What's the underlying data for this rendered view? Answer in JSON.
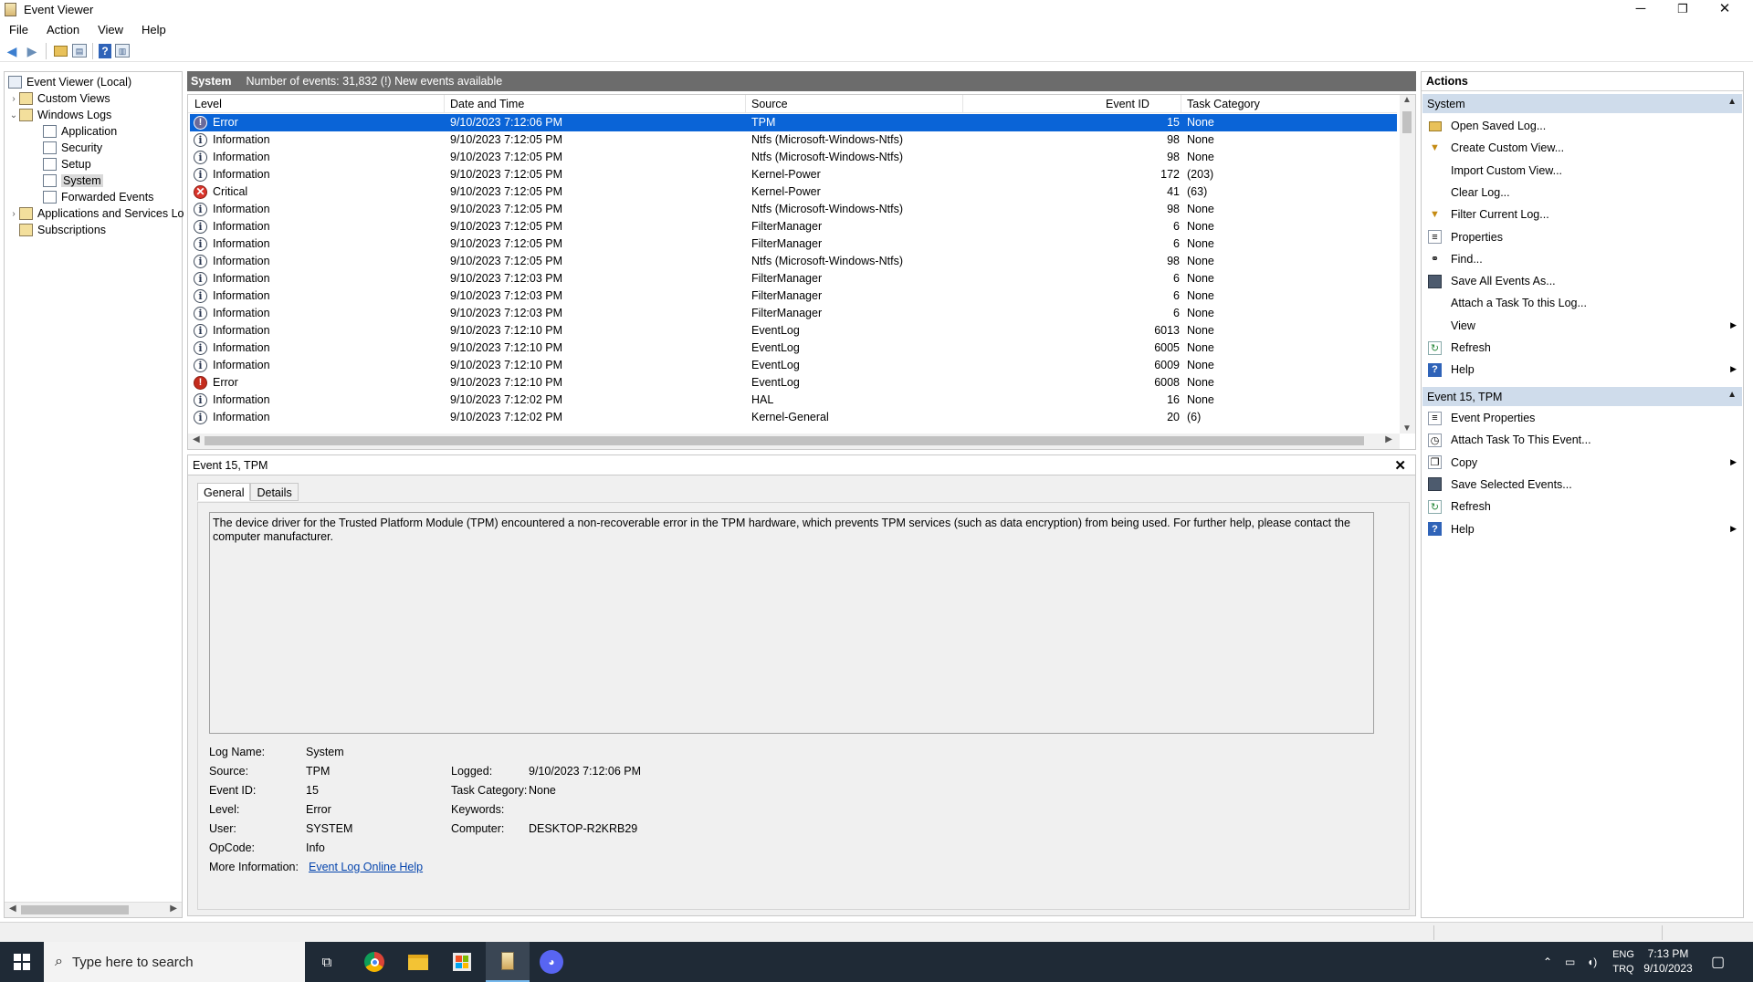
{
  "window": {
    "title": "Event Viewer",
    "controls": {
      "minimize": "─",
      "restore": "❐",
      "close": "✕"
    }
  },
  "menu": [
    "File",
    "Action",
    "View",
    "Help"
  ],
  "toolbar": [
    "back-icon",
    "forward-icon",
    "up-folder-icon",
    "show-hide-console-tree-icon",
    "help-icon",
    "show-hide-action-pane-icon"
  ],
  "tree": {
    "root": "Event Viewer (Local)",
    "custom_views": "Custom Views",
    "windows_logs": "Windows Logs",
    "logs": [
      "Application",
      "Security",
      "Setup",
      "System",
      "Forwarded Events"
    ],
    "apps_services": "Applications and Services Lo",
    "subscriptions": "Subscriptions",
    "selected": "System"
  },
  "list": {
    "title": "System",
    "summary": "Number of events: 31,832 (!) New events available",
    "columns": [
      "Level",
      "Date and Time",
      "Source",
      "Event ID",
      "Task Category"
    ],
    "rows": [
      {
        "level": "Error",
        "icon": "error",
        "date": "9/10/2023 7:12:06 PM",
        "source": "TPM",
        "id": "15",
        "cat": "None"
      },
      {
        "level": "Information",
        "icon": "info",
        "date": "9/10/2023 7:12:05 PM",
        "source": "Ntfs (Microsoft-Windows-Ntfs)",
        "id": "98",
        "cat": "None"
      },
      {
        "level": "Information",
        "icon": "info",
        "date": "9/10/2023 7:12:05 PM",
        "source": "Ntfs (Microsoft-Windows-Ntfs)",
        "id": "98",
        "cat": "None"
      },
      {
        "level": "Information",
        "icon": "info",
        "date": "9/10/2023 7:12:05 PM",
        "source": "Kernel-Power",
        "id": "172",
        "cat": "(203)"
      },
      {
        "level": "Critical",
        "icon": "critical",
        "date": "9/10/2023 7:12:05 PM",
        "source": "Kernel-Power",
        "id": "41",
        "cat": "(63)"
      },
      {
        "level": "Information",
        "icon": "info",
        "date": "9/10/2023 7:12:05 PM",
        "source": "Ntfs (Microsoft-Windows-Ntfs)",
        "id": "98",
        "cat": "None"
      },
      {
        "level": "Information",
        "icon": "info",
        "date": "9/10/2023 7:12:05 PM",
        "source": "FilterManager",
        "id": "6",
        "cat": "None"
      },
      {
        "level": "Information",
        "icon": "info",
        "date": "9/10/2023 7:12:05 PM",
        "source": "FilterManager",
        "id": "6",
        "cat": "None"
      },
      {
        "level": "Information",
        "icon": "info",
        "date": "9/10/2023 7:12:05 PM",
        "source": "Ntfs (Microsoft-Windows-Ntfs)",
        "id": "98",
        "cat": "None"
      },
      {
        "level": "Information",
        "icon": "info",
        "date": "9/10/2023 7:12:03 PM",
        "source": "FilterManager",
        "id": "6",
        "cat": "None"
      },
      {
        "level": "Information",
        "icon": "info",
        "date": "9/10/2023 7:12:03 PM",
        "source": "FilterManager",
        "id": "6",
        "cat": "None"
      },
      {
        "level": "Information",
        "icon": "info",
        "date": "9/10/2023 7:12:03 PM",
        "source": "FilterManager",
        "id": "6",
        "cat": "None"
      },
      {
        "level": "Information",
        "icon": "info",
        "date": "9/10/2023 7:12:10 PM",
        "source": "EventLog",
        "id": "6013",
        "cat": "None"
      },
      {
        "level": "Information",
        "icon": "info",
        "date": "9/10/2023 7:12:10 PM",
        "source": "EventLog",
        "id": "6005",
        "cat": "None"
      },
      {
        "level": "Information",
        "icon": "info",
        "date": "9/10/2023 7:12:10 PM",
        "source": "EventLog",
        "id": "6009",
        "cat": "None"
      },
      {
        "level": "Error",
        "icon": "error",
        "date": "9/10/2023 7:12:10 PM",
        "source": "EventLog",
        "id": "6008",
        "cat": "None"
      },
      {
        "level": "Information",
        "icon": "info",
        "date": "9/10/2023 7:12:02 PM",
        "source": "HAL",
        "id": "16",
        "cat": "None"
      },
      {
        "level": "Information",
        "icon": "info",
        "date": "9/10/2023 7:12:02 PM",
        "source": "Kernel-General",
        "id": "20",
        "cat": "(6)"
      }
    ]
  },
  "detail": {
    "header": "Event 15, TPM",
    "close": "✕",
    "tabs": [
      "General",
      "Details"
    ],
    "description": "The device driver for the Trusted Platform Module (TPM) encountered a non-recoverable error in the TPM hardware, which prevents TPM services (such as data encryption) from being used. For further help, please contact the computer manufacturer.",
    "labels": {
      "log_name": "Log Name:",
      "source": "Source:",
      "event_id": "Event ID:",
      "level": "Level:",
      "user": "User:",
      "opcode": "OpCode:",
      "more_info": "More Information:",
      "logged": "Logged:",
      "task_category": "Task Category:",
      "keywords": "Keywords:",
      "computer": "Computer:"
    },
    "values": {
      "log_name": "System",
      "source": "TPM",
      "event_id": "15",
      "level": "Error",
      "user": "SYSTEM",
      "opcode": "Info",
      "logged": "9/10/2023 7:12:06 PM",
      "task_category": "None",
      "keywords": "",
      "computer": "DESKTOP-R2KRB29"
    },
    "more_info_link": "Event Log Online Help"
  },
  "actions": {
    "title": "Actions",
    "section1": "System",
    "items1": [
      {
        "label": "Open Saved Log...",
        "icon": "folder-open-icon",
        "sub": false
      },
      {
        "label": "Create Custom View...",
        "icon": "filter-icon",
        "sub": false
      },
      {
        "label": "Import Custom View...",
        "icon": "",
        "sub": false
      },
      {
        "label": "Clear Log...",
        "icon": "",
        "sub": false
      },
      {
        "label": "Filter Current Log...",
        "icon": "filter-icon",
        "sub": false
      },
      {
        "label": "Properties",
        "icon": "properties-icon",
        "sub": false
      },
      {
        "label": "Find...",
        "icon": "binoculars-icon",
        "sub": false
      },
      {
        "label": "Save All Events As...",
        "icon": "save-icon",
        "sub": false
      },
      {
        "label": "Attach a Task To this Log...",
        "icon": "",
        "sub": false
      },
      {
        "label": "View",
        "icon": "",
        "sub": true
      },
      {
        "label": "Refresh",
        "icon": "refresh-icon",
        "sub": false
      },
      {
        "label": "Help",
        "icon": "help-icon",
        "sub": true
      }
    ],
    "section2": "Event 15, TPM",
    "items2": [
      {
        "label": "Event Properties",
        "icon": "properties-icon",
        "sub": false
      },
      {
        "label": "Attach Task To This Event...",
        "icon": "task-icon",
        "sub": false
      },
      {
        "label": "Copy",
        "icon": "copy-icon",
        "sub": true
      },
      {
        "label": "Save Selected Events...",
        "icon": "save-icon",
        "sub": false
      },
      {
        "label": "Refresh",
        "icon": "refresh-icon",
        "sub": false
      },
      {
        "label": "Help",
        "icon": "help-icon",
        "sub": true
      }
    ]
  },
  "taskbar": {
    "search_placeholder": "Type here to search",
    "lang": "ENG",
    "layout": "TRQ",
    "time": "7:13 PM",
    "date": "9/10/2023"
  },
  "colors": {
    "selection": "#0a64d7",
    "section_header": "#cfdceb",
    "taskbar": "#1f2a36",
    "list_title": "#6c6c6c"
  }
}
